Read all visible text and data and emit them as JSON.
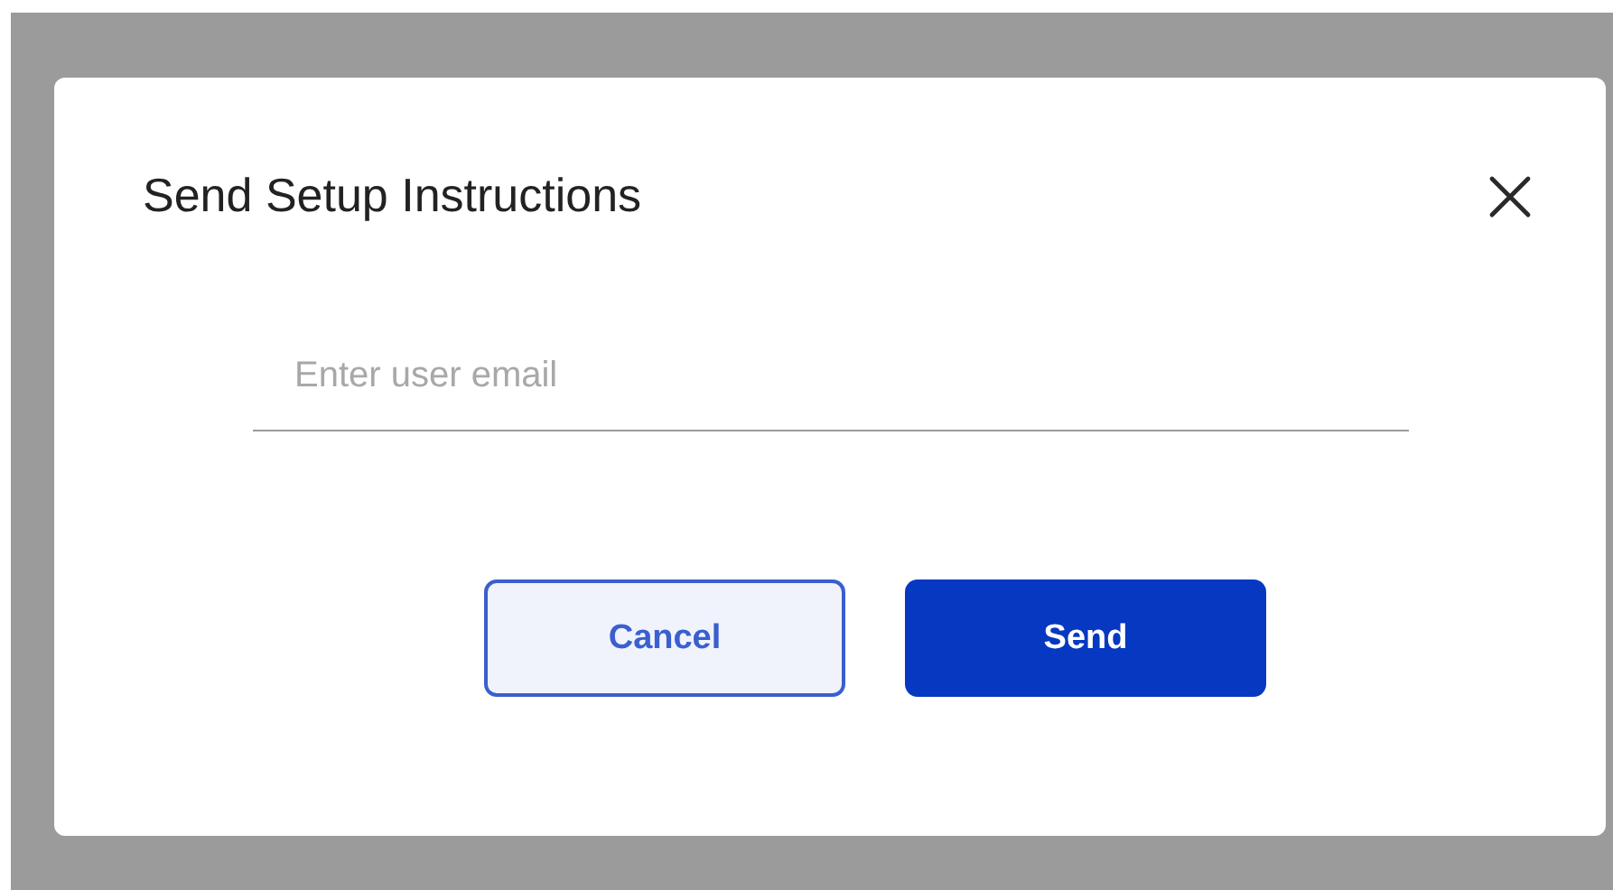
{
  "dialog": {
    "title": "Send Setup Instructions",
    "email_field": {
      "placeholder": "Enter user email"
    },
    "buttons": [
      {
        "label": "Cancel",
        "kind": "secondary"
      },
      {
        "label": "Send",
        "kind": "primary"
      }
    ]
  }
}
